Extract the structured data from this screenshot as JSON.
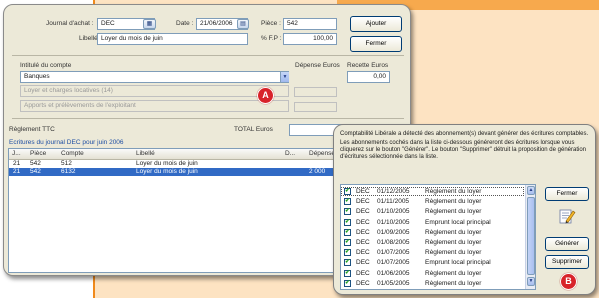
{
  "main": {
    "journal_label": "Journal d'achat :",
    "journal_value": "DEC",
    "date_label": "Date :",
    "date_value": "21/06/2006",
    "piece_label": "Pièce :",
    "piece_value": "542",
    "libelle_label": "Libellé",
    "libelle_value": "Loyer du mois de juin",
    "pct_label": "% F.P :",
    "pct_value": "100,00",
    "ajouter_label": "Ajouter",
    "fermer_label": "Fermer",
    "intitule_header": "Intitulé du compte",
    "depense_header": "Dépense Euros",
    "recette_header": "Recette Euros",
    "accounts": [
      {
        "label": "Banques",
        "disabled": false
      },
      {
        "label": "Loyer et charges locatives (14)",
        "disabled": true
      },
      {
        "label": "Apports et prélèvements de l'exploitant",
        "disabled": true
      }
    ],
    "recette_value": "0,00",
    "reglement_label": "Règlement TTC",
    "total_label": "TOTAL Euros",
    "ecritures_title": "Ecritures du journal DEC pour juin 2006",
    "columns": [
      "J...",
      "Pièce",
      "Compte",
      "Libellé",
      "D...",
      "Dépense"
    ],
    "rows": [
      {
        "j": "21",
        "piece": "542",
        "compte": "512",
        "libelle": "Loyer du mois de juin",
        "d": "",
        "depense": ""
      },
      {
        "j": "21",
        "piece": "542",
        "compte": "6132",
        "libelle": "Loyer du mois de juin",
        "d": "",
        "depense": "2 000"
      }
    ],
    "badge": "A"
  },
  "popup": {
    "message1": "Comptabilité Libérale a détecté des abonnement(s) devant générer des écritures comptables.",
    "message2": "Les abonnements cochés dans la liste ci-dessous généreront des écritures lorsque vous cliquerez sur le bouton \"Générer\". Le bouton \"Supprimer\" détruit la proposition de génération d'écritures sélectionnée dans la liste.",
    "items": [
      {
        "journal": "DEC",
        "date": "01/12/2005",
        "label": "Règlement du loyer"
      },
      {
        "journal": "DEC",
        "date": "01/11/2005",
        "label": "Règlement du loyer"
      },
      {
        "journal": "DEC",
        "date": "01/10/2005",
        "label": "Règlement du loyer"
      },
      {
        "journal": "DEC",
        "date": "01/10/2005",
        "label": "Emprunt local principal"
      },
      {
        "journal": "DEC",
        "date": "01/09/2005",
        "label": "Règlement du loyer"
      },
      {
        "journal": "DEC",
        "date": "01/08/2005",
        "label": "Règlement du loyer"
      },
      {
        "journal": "DEC",
        "date": "01/07/2005",
        "label": "Règlement du loyer"
      },
      {
        "journal": "DEC",
        "date": "01/07/2005",
        "label": "Emprunt local principal"
      },
      {
        "journal": "DEC",
        "date": "01/06/2005",
        "label": "Règlement du loyer"
      },
      {
        "journal": "DEC",
        "date": "01/05/2005",
        "label": "Règlement du loyer"
      }
    ],
    "fermer_label": "Fermer",
    "generer_label": "Générer",
    "supprimer_label": "Supprimer",
    "badge": "B"
  },
  "colors": {
    "accent": "#f08a1c",
    "peach": "#fde3c2",
    "selection": "#316ac5",
    "badge": "#d8232a"
  }
}
